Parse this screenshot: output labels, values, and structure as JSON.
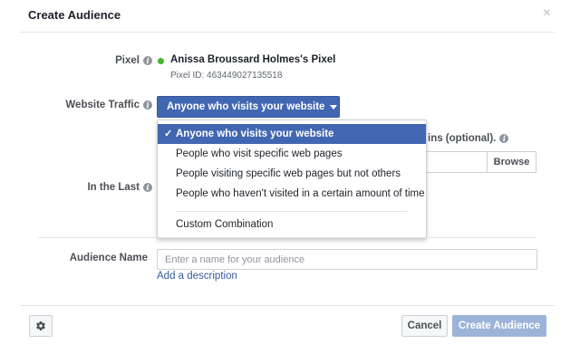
{
  "dialog": {
    "title": "Create Audience",
    "close_symbol": "×"
  },
  "pixel": {
    "label": "Pixel",
    "name": "Anissa Broussard Holmes's Pixel",
    "id_text": "Pixel ID: 463449027135518",
    "status_color": "#42b72a"
  },
  "website_traffic": {
    "label": "Website Traffic",
    "selected": "Anyone who visits your website",
    "options": [
      "Anyone who visits your website",
      "People who visit specific web pages",
      "People visiting specific web pages but not others",
      "People who haven't visited in a certain amount of time",
      "Custom Combination"
    ],
    "check_symbol": "✓"
  },
  "behind_dropdown": {
    "partial_text": "ins (optional).",
    "browse_label": "Browse"
  },
  "in_the_last": {
    "label": "In the Last"
  },
  "audience_name": {
    "label": "Audience Name",
    "placeholder": "Enter a name for your audience",
    "value": "",
    "add_description": "Add a description"
  },
  "footer": {
    "cancel_label": "Cancel",
    "create_label": "Create Audience",
    "settings_icon": "gear-icon"
  },
  "colors": {
    "primary": "#4267b2",
    "disabled_primary": "#9cb4d8",
    "link": "#365899"
  }
}
